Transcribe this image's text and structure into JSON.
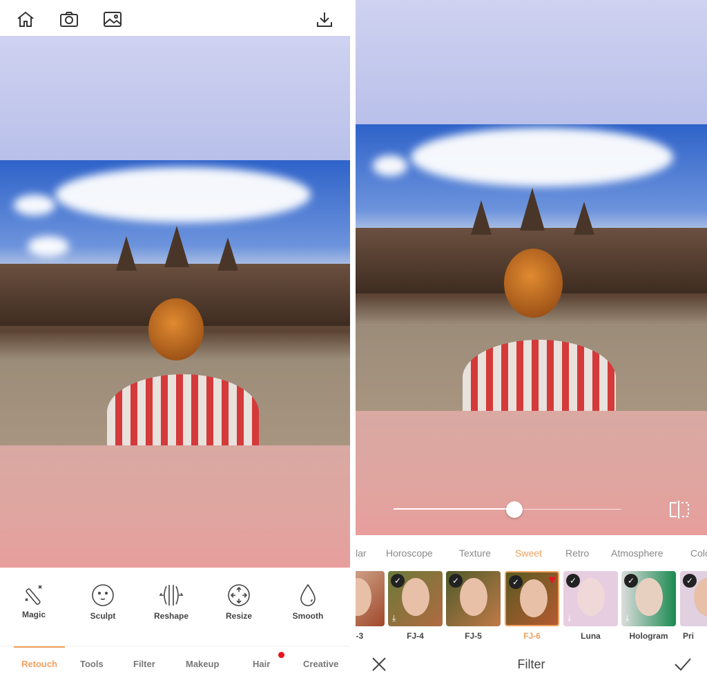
{
  "left": {
    "topbar": {
      "icons": [
        "home-icon",
        "camera-icon",
        "gallery-icon",
        "download-icon"
      ]
    },
    "tools": [
      {
        "label": "Magic",
        "icon": "magic-wand-icon"
      },
      {
        "label": "Sculpt",
        "icon": "face-icon"
      },
      {
        "label": "Reshape",
        "icon": "reshape-icon"
      },
      {
        "label": "Resize",
        "icon": "resize-icon"
      },
      {
        "label": "Smooth",
        "icon": "drop-icon"
      }
    ],
    "tabs": [
      {
        "label": "Retouch",
        "active": true
      },
      {
        "label": "Tools"
      },
      {
        "label": "Filter"
      },
      {
        "label": "Makeup"
      },
      {
        "label": "Hair",
        "badge": true
      },
      {
        "label": "Creative"
      }
    ]
  },
  "right": {
    "slider": {
      "value": 0.53
    },
    "categories": [
      {
        "label": "lar"
      },
      {
        "label": "Horoscope"
      },
      {
        "label": "Texture"
      },
      {
        "label": "Sweet",
        "active": true
      },
      {
        "label": "Retro"
      },
      {
        "label": "Atmosphere"
      },
      {
        "label": "Colo"
      }
    ],
    "filters": [
      {
        "label": "J-3"
      },
      {
        "label": "FJ-4"
      },
      {
        "label": "FJ-5"
      },
      {
        "label": "FJ-6",
        "selected": true,
        "favorite": true
      },
      {
        "label": "Luna"
      },
      {
        "label": "Hologram"
      },
      {
        "label": "Pri"
      }
    ],
    "bottombar": {
      "title": "Filter",
      "cancel_icon": "close-icon",
      "confirm_icon": "check-icon"
    }
  },
  "colors": {
    "accent": "#f0a060",
    "badge": "#e8141e",
    "text": "#444444"
  }
}
